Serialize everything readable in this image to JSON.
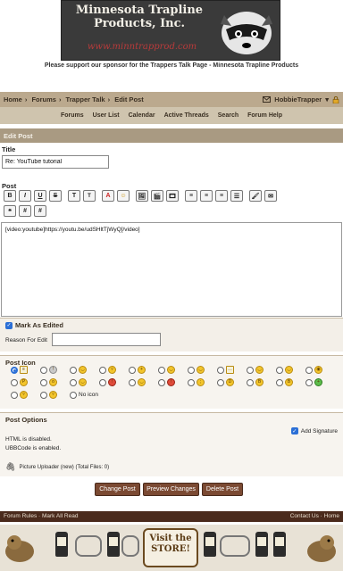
{
  "banner": {
    "title_line1": "Minnesota Trapline",
    "title_line2": "Products, Inc.",
    "url": "www.minntrapprod.com",
    "sponsor_text": "Please support our sponsor for the Trappers Talk Page - Minnesota Trapline Products"
  },
  "navbar": {
    "crumbs": [
      "Home",
      "Forums",
      "Trapper Talk",
      "Edit Post"
    ],
    "separator": "›",
    "username": "HobbieTrapper",
    "caret": "▾"
  },
  "subnav": {
    "items": [
      "Forums",
      "User List",
      "Calendar",
      "Active Threads",
      "Search",
      "Forum Help"
    ]
  },
  "edit_post": {
    "header": "Edit Post",
    "title_label": "Title",
    "title_value": "Re: YouTube tutorial",
    "post_label": "Post",
    "toolbar_row1": [
      "B",
      "I",
      "U",
      "S",
      "T",
      "T",
      "A",
      "☺",
      "🖼",
      "🎬",
      "🎞",
      "≡",
      "≡",
      "≡",
      "☰",
      "🖌",
      "✉"
    ],
    "toolbar_row2": [
      "❝",
      "#",
      "#"
    ],
    "body": "[video:youtube]https://youtu.be/udSHltTjWyQ[/video]"
  },
  "mark_as_edited": {
    "label": "Mark As Edited",
    "checked": true,
    "reason_label": "Reason For Edit",
    "reason_value": ""
  },
  "post_icon": {
    "title": "Post Icon",
    "selected_index": 0,
    "icons": [
      "doc",
      "bulb",
      "smile",
      "grin",
      "thumb",
      "smile",
      "smile",
      "speech",
      "smile",
      "smile",
      "eye",
      "tongue",
      "shock",
      "smile",
      "red",
      "smile",
      "red",
      "wink",
      "laugh",
      "cool",
      "cool",
      "green",
      "grin",
      "grin"
    ],
    "no_icon_label": "No icon"
  },
  "post_options": {
    "title": "Post Options",
    "add_signature_label": "Add Signature",
    "add_signature_checked": true,
    "html_status": "HTML is disabled.",
    "ubb_status": "UBBCode is enabled.",
    "uploader_text": "Picture Uploader (new) (Total Files: 0)"
  },
  "buttons": {
    "change_post": "Change Post",
    "preview_changes": "Preview Changes",
    "delete_post": "Delete Post"
  },
  "footer": {
    "left": "Forum Rules · Mark All Read",
    "right": "Contact Us · Home"
  },
  "store": {
    "line1": "Visit the",
    "line2": "STORE!"
  }
}
